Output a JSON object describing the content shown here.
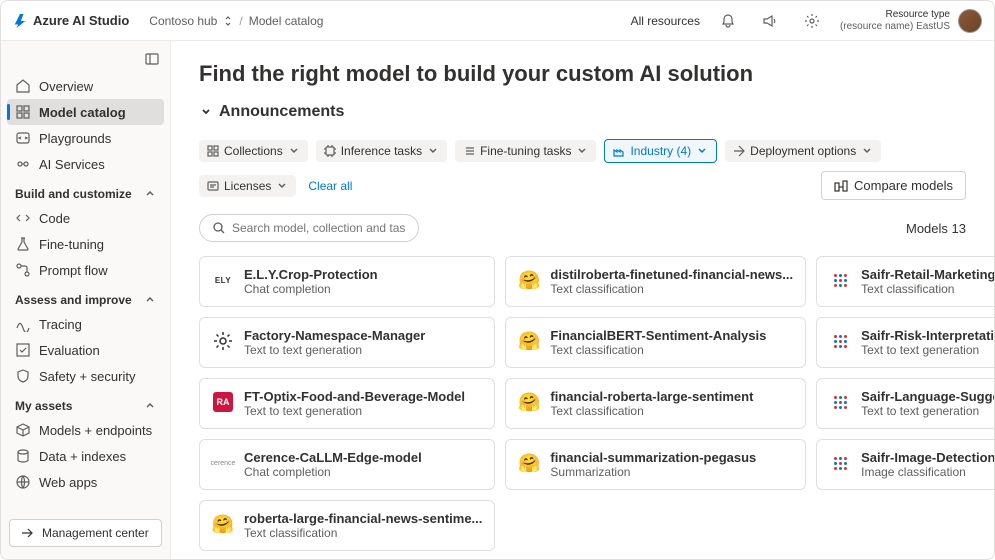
{
  "brand": "Azure AI Studio",
  "breadcrumb": {
    "hub": "Contoso hub",
    "page": "Model catalog"
  },
  "top": {
    "all_resources": "All resources",
    "resource_type": "Resource type",
    "resource_name": "(resource name) EastUS"
  },
  "sidebar": {
    "items_top": [
      {
        "label": "Overview",
        "icon": "home"
      },
      {
        "label": "Model catalog",
        "icon": "catalog",
        "active": true
      },
      {
        "label": "Playgrounds",
        "icon": "playground"
      },
      {
        "label": "AI Services",
        "icon": "ai"
      }
    ],
    "section_build": "Build and customize",
    "items_build": [
      {
        "label": "Code",
        "icon": "code"
      },
      {
        "label": "Fine-tuning",
        "icon": "flask"
      },
      {
        "label": "Prompt flow",
        "icon": "flow"
      }
    ],
    "section_assess": "Assess and improve",
    "items_assess": [
      {
        "label": "Tracing",
        "icon": "trace"
      },
      {
        "label": "Evaluation",
        "icon": "eval"
      },
      {
        "label": "Safety + security",
        "icon": "shield"
      }
    ],
    "section_assets": "My assets",
    "items_assets": [
      {
        "label": "Models + endpoints",
        "icon": "cube"
      },
      {
        "label": "Data + indexes",
        "icon": "data"
      },
      {
        "label": "Web apps",
        "icon": "web"
      }
    ],
    "management": "Management center"
  },
  "main": {
    "title": "Find the right model to build your custom AI solution",
    "announcements": "Announcements",
    "filters": [
      {
        "label": "Collections",
        "icon": "grid"
      },
      {
        "label": "Inference tasks",
        "icon": "chip"
      },
      {
        "label": "Fine-tuning tasks",
        "icon": "list"
      },
      {
        "label": "Industry (4)",
        "icon": "industry",
        "active": true
      },
      {
        "label": "Deployment options",
        "icon": "deploy"
      },
      {
        "label": "Licenses",
        "icon": "license"
      }
    ],
    "clear": "Clear all",
    "compare": "Compare models",
    "search_placeholder": "Search model, collection and tasks",
    "count_label": "Models",
    "count": "13",
    "models": [
      {
        "title": "E.L.Y.Crop-Protection",
        "sub": "Chat completion",
        "icon": "ely"
      },
      {
        "title": "distilroberta-finetuned-financial-news...",
        "sub": "Text classification",
        "icon": "hf"
      },
      {
        "title": "Saifr-Retail-Marketing-Compliance",
        "sub": "Text classification",
        "icon": "saifr"
      },
      {
        "title": "Factory-Namespace-Manager",
        "sub": "Text to text generation",
        "icon": "gear"
      },
      {
        "title": "FinancialBERT-Sentiment-Analysis",
        "sub": "Text classification",
        "icon": "hf"
      },
      {
        "title": "Saifr-Risk-Interpretation",
        "sub": "Text to text generation",
        "icon": "saifr"
      },
      {
        "title": "FT-Optix-Food-and-Beverage-Model",
        "sub": "Text to text generation",
        "icon": "ra"
      },
      {
        "title": "financial-roberta-large-sentiment",
        "sub": "Text classification",
        "icon": "hf"
      },
      {
        "title": "Saifr-Language-Suggestion",
        "sub": "Text to text generation",
        "icon": "saifr"
      },
      {
        "title": "Cerence-CaLLM-Edge-model",
        "sub": "Chat completion",
        "icon": "cerence"
      },
      {
        "title": "financial-summarization-pegasus",
        "sub": "Summarization",
        "icon": "hf"
      },
      {
        "title": "Saifr-Image-Detection",
        "sub": "Image classification",
        "icon": "saifr"
      },
      {
        "title": "roberta-large-financial-news-sentime...",
        "sub": "Text classification",
        "icon": "hf"
      }
    ]
  }
}
